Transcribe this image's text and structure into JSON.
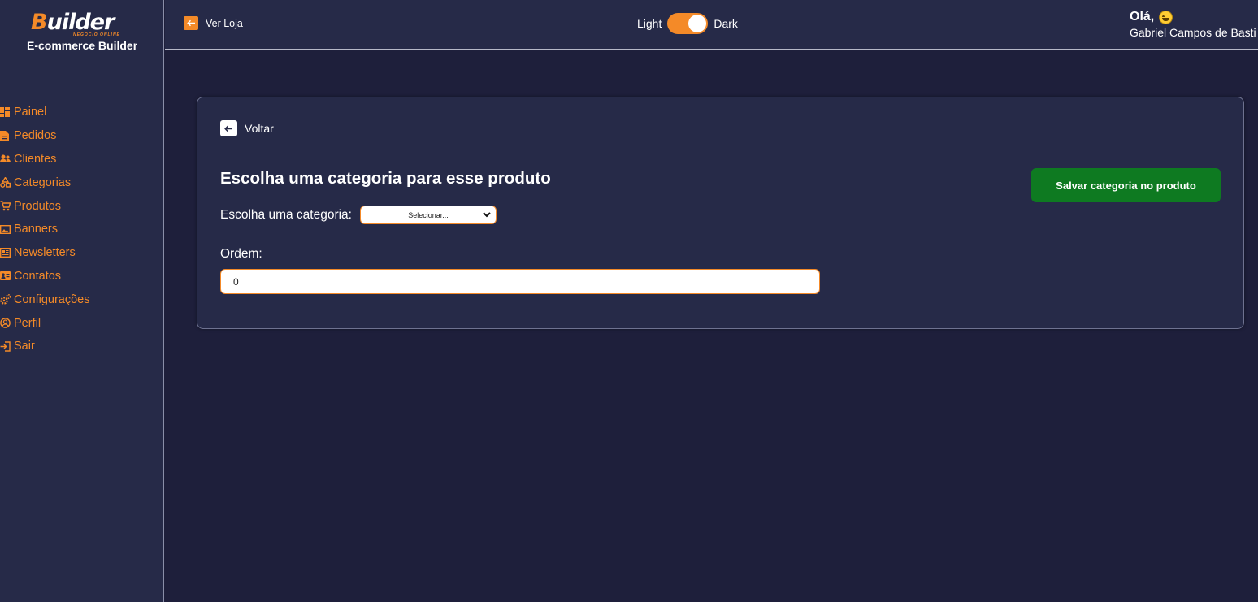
{
  "brand": {
    "logo_text": "Builder",
    "logo_tagline": "NEGÓCIO ONLINE",
    "subtitle": "E-commerce Builder"
  },
  "sidebar": {
    "items": [
      {
        "label": "Painel",
        "icon": "dashboard-icon"
      },
      {
        "label": "Pedidos",
        "icon": "document-icon"
      },
      {
        "label": "Clientes",
        "icon": "users-icon"
      },
      {
        "label": "Categorias",
        "icon": "shapes-icon"
      },
      {
        "label": "Produtos",
        "icon": "cart-icon"
      },
      {
        "label": "Banners",
        "icon": "image-icon"
      },
      {
        "label": "Newsletters",
        "icon": "newspaper-icon"
      },
      {
        "label": "Contatos",
        "icon": "contact-card-icon"
      },
      {
        "label": "Configurações",
        "icon": "gears-icon"
      },
      {
        "label": "Perfil",
        "icon": "user-circle-icon"
      },
      {
        "label": "Sair",
        "icon": "logout-icon"
      }
    ]
  },
  "topbar": {
    "store_link": "Ver Loja",
    "theme_light": "Light",
    "theme_dark": "Dark",
    "theme_mode": "dark",
    "greeting": "Olá,",
    "user_name": "Gabriel Campos de Basti"
  },
  "form": {
    "back_label": "Voltar",
    "title": "Escolha uma categoria para esse produto",
    "category_label": "Escolha uma categoria:",
    "category_selected": "Selecionar...",
    "order_label": "Ordem:",
    "order_value": "0",
    "save_button": "Salvar categoria no produto"
  },
  "colors": {
    "accent": "#f48a28",
    "background": "#1e1f3b",
    "panel": "#262a48",
    "save_button": "#0e7a21"
  }
}
